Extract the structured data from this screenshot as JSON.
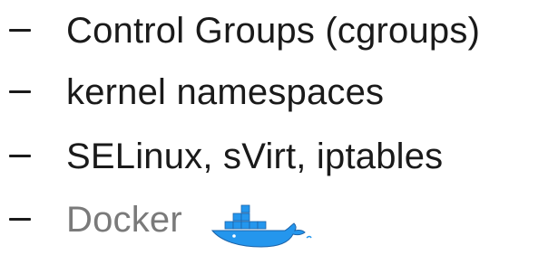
{
  "colors": {
    "text_dark": "#1a1a1a",
    "text_muted": "#7a7a7a",
    "docker_blue": "#2496ed",
    "docker_dark": "#1d63a8"
  },
  "bullets": [
    {
      "dash": "–",
      "text": "Control Groups (cgroups)"
    },
    {
      "dash": "–",
      "text": "kernel namespaces"
    },
    {
      "dash": "–",
      "text": "SELinux, sVirt, iptables"
    },
    {
      "dash": "–",
      "text": "Docker",
      "icon": "docker-whale-icon"
    }
  ]
}
